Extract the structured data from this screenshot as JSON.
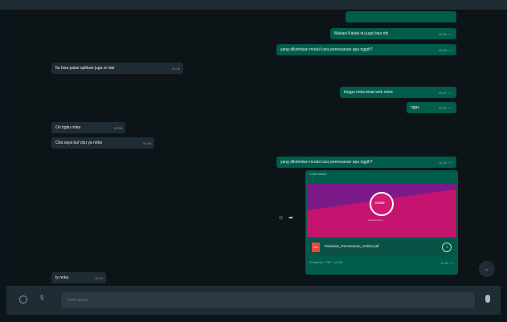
{
  "messages": [
    {
      "side": "out",
      "text": "",
      "time": "",
      "left": "",
      "top": ""
    },
    {
      "side": "out",
      "text": "Makasi Kakak itu juga bisa nih",
      "time": "09.52 ✓✓"
    },
    {
      "side": "out",
      "text": "yang dikirimkan modul cara pemesanan apa nggih?",
      "time": "09.53 ✓✓"
    },
    {
      "side": "in",
      "text": "Itu bisa pakai aplikasi juga ni ntar",
      "time": "09.55"
    },
    {
      "side": "out",
      "text": "tinggu nnka bisat web nnka",
      "time": "09.57 ✓✓"
    },
    {
      "side": "out",
      "text": "nggs",
      "time": "09.57 ✓✓"
    },
    {
      "side": "in",
      "text": "Oo bgitu nnka",
      "time": "09.58"
    },
    {
      "side": "in",
      "text": "Cba saya buf cbu ya nnka",
      "time": "09.58"
    },
    {
      "side": "out",
      "text": "yang dikirimkan modul cara pemesanan apa nggih?",
      "time": "10.02 ✓✓"
    },
    {
      "side": "in",
      "text": "ty nnka",
      "time": "10.04"
    }
  ],
  "forwarded_card": {
    "label": "⤷ Diteruskan",
    "logo_text": "ecaw",
    "logo_sub": "ecaw learning",
    "file_type": "PDF",
    "file_name": "Panduan_Pemesanan_Online.pdf",
    "download_icon": "download-icon",
    "meta": "10 halaman · PDF · 2,3 MB",
    "time": "10.03 ✓✓"
  },
  "actions": {
    "forward_icon": "share-icon",
    "emoji_icon": "smile-icon"
  },
  "composer": {
    "placeholder": "Ketik pesan"
  },
  "colors": {
    "outgoing": "#005c4b",
    "incoming": "#202c33",
    "background": "#0b141a",
    "accent": "#c4146f"
  }
}
